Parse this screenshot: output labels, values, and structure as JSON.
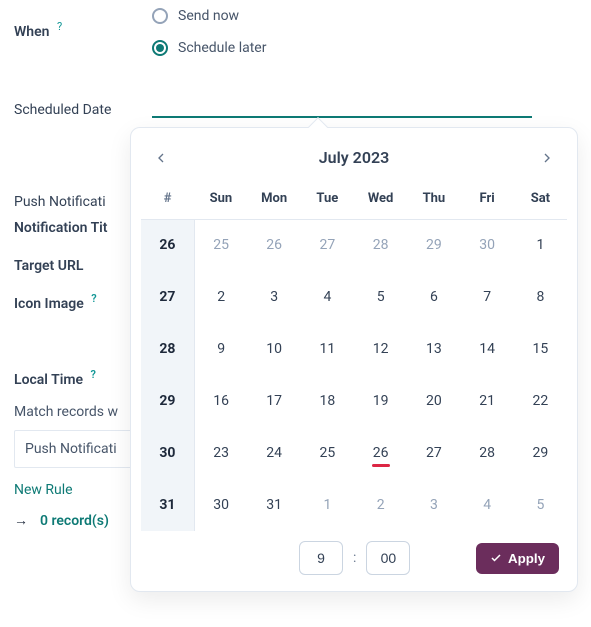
{
  "form": {
    "when_label": "When",
    "help_symbol": "?",
    "send_now_label": "Send now",
    "schedule_later_label": "Schedule later",
    "scheduled_date_label": "Scheduled Date",
    "scheduled_date_value": "",
    "push_header": "Push Notificati",
    "title_label": "Notification Tit",
    "target_label": "Target URL",
    "icon_label": "Icon Image",
    "local_time_label": "Local Time",
    "match_text": "Match records w",
    "match_box_text": "Push Notificati",
    "new_rule": "New Rule",
    "arrow_symbol": "→",
    "records_text": "0 record(s)"
  },
  "calendar": {
    "title": "July 2023",
    "dow_header": [
      "#",
      "Sun",
      "Mon",
      "Tue",
      "Wed",
      "Thu",
      "Fri",
      "Sat"
    ],
    "weeks": [
      {
        "wk": "26",
        "days": [
          {
            "n": "25",
            "other": true
          },
          {
            "n": "26",
            "other": true
          },
          {
            "n": "27",
            "other": true
          },
          {
            "n": "28",
            "other": true
          },
          {
            "n": "29",
            "other": true
          },
          {
            "n": "30",
            "other": true
          },
          {
            "n": "1"
          }
        ]
      },
      {
        "wk": "27",
        "days": [
          {
            "n": "2"
          },
          {
            "n": "3"
          },
          {
            "n": "4"
          },
          {
            "n": "5"
          },
          {
            "n": "6"
          },
          {
            "n": "7"
          },
          {
            "n": "8"
          }
        ]
      },
      {
        "wk": "28",
        "days": [
          {
            "n": "9"
          },
          {
            "n": "10"
          },
          {
            "n": "11"
          },
          {
            "n": "12"
          },
          {
            "n": "13"
          },
          {
            "n": "14"
          },
          {
            "n": "15"
          }
        ]
      },
      {
        "wk": "29",
        "days": [
          {
            "n": "16"
          },
          {
            "n": "17"
          },
          {
            "n": "18"
          },
          {
            "n": "19"
          },
          {
            "n": "20"
          },
          {
            "n": "21"
          },
          {
            "n": "22"
          }
        ]
      },
      {
        "wk": "30",
        "days": [
          {
            "n": "23"
          },
          {
            "n": "24"
          },
          {
            "n": "25"
          },
          {
            "n": "26",
            "today": true
          },
          {
            "n": "27"
          },
          {
            "n": "28"
          },
          {
            "n": "29"
          }
        ]
      },
      {
        "wk": "31",
        "days": [
          {
            "n": "30"
          },
          {
            "n": "31"
          },
          {
            "n": "1",
            "other": true
          },
          {
            "n": "2",
            "other": true
          },
          {
            "n": "3",
            "other": true
          },
          {
            "n": "4",
            "other": true
          },
          {
            "n": "5",
            "other": true
          }
        ]
      }
    ],
    "time_hour": "9",
    "time_minute": "00",
    "colon": ":",
    "apply_label": "Apply"
  }
}
